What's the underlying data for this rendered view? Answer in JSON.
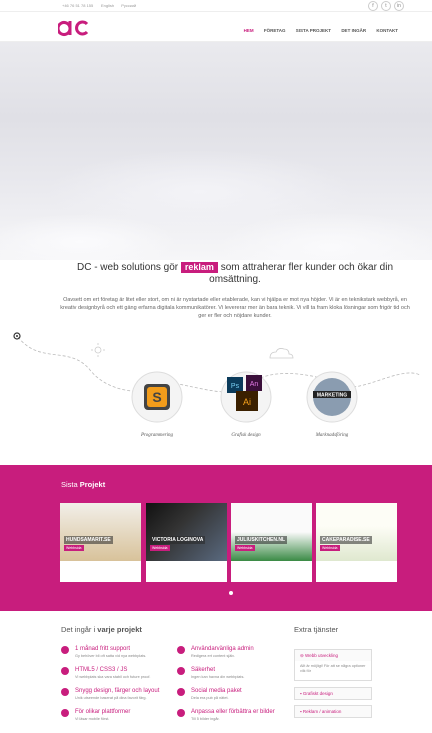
{
  "topbar": {
    "phone": "+46 76 51 78 155",
    "langs": [
      "English",
      "Pусский"
    ]
  },
  "nav": {
    "items": [
      "HEM",
      "FÖRETAG",
      "SISTA PROJEKT",
      "DET INGÅR",
      "KONTAKT"
    ]
  },
  "tagline": {
    "before": "DC - web solutions gör",
    "highlight": "reklam",
    "after": "som attraherar fler kunder och ökar din omsättning."
  },
  "intro": "Oavsett om ert företag är litet eller stort, om ni är nystartade eller etablerade, kan vi hjälpa er mot nya höjder. Vi är en teknikstark webbyrå, en kreativ designbyrå och ett gäng erfarna digitala kommunikatörer. Vi levererar mer än bara teknik. Vi vill ta fram kloka lösningar som frigör tid och ger er fler och nöjdare kunder.",
  "process": {
    "labels": [
      "Programmering",
      "Grafisk design",
      "Marknadsföring"
    ],
    "icons": [
      "sublime-icon",
      "adobe-icon",
      "marketing-ball-icon"
    ]
  },
  "projects": {
    "title_prefix": "Sista ",
    "title_bold": "Projekt",
    "cards": [
      {
        "name": "HUNDSAMARIT.SE",
        "tag": "Webbsida",
        "colors": [
          "#e9d7b6",
          "#caa36a"
        ]
      },
      {
        "name": "VICTORIA LOGINOVA",
        "tag": "Webbsida",
        "colors": [
          "#1b1b1b",
          "#5a6a80"
        ]
      },
      {
        "name": "JULIUSKITCHEN.NL",
        "tag": "Webbsida",
        "colors": [
          "#f4f4f4",
          "#2f7d3a"
        ]
      },
      {
        "name": "CAKEPARADISE.SE",
        "tag": "Webbsida",
        "colors": [
          "#fdfdf6",
          "#8aa86a"
        ]
      }
    ]
  },
  "included": {
    "title_prefix": "Det ingår i ",
    "title_bold": "varje projekt",
    "features": [
      {
        "title": "1 månad fritt support",
        "desc": "Gy behöver bli oft satta vid nya webbplats."
      },
      {
        "title": "HTML5 / CSS3 / JS",
        "desc": "Vi webbplats ska vara stabil och future proof."
      },
      {
        "title": "Snygg design, färger och layout",
        "desc": "Unik utseende baserat på dina favorit färg."
      },
      {
        "title": "För olikar plattformer",
        "desc": "Vi läsar mobile först."
      },
      {
        "title": "Användarvänliga admin",
        "desc": "Redigera ert content själv."
      },
      {
        "title": "Säkerhet",
        "desc": "Ingen kan havna din webbplats."
      },
      {
        "title": "Social media paket",
        "desc": "Dela era pub på nätet."
      },
      {
        "title": "Anpassa eller förbättra er bilder",
        "desc": "Till 5 bilder ingår."
      }
    ]
  },
  "extra": {
    "title": "Extra tjänster",
    "items": [
      "Webb utveckling",
      "Grafiskt design",
      "Reklam / animation"
    ],
    "open_text": "Allt är möjligt! För att se några optioner vilk för"
  },
  "colors": {
    "accent": "#c81d7d"
  }
}
